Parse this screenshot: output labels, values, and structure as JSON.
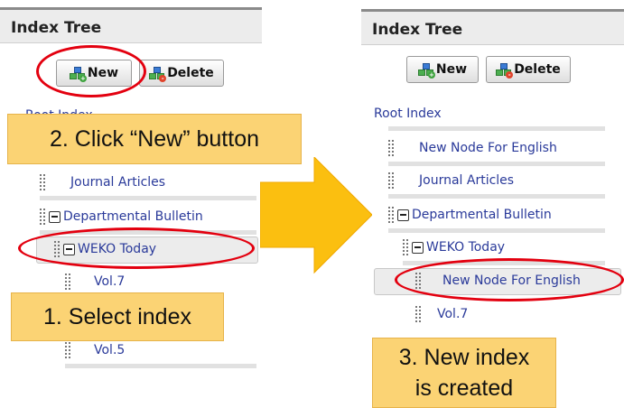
{
  "left_panel": {
    "title": "Index Tree",
    "new_label": "New",
    "delete_label": "Delete",
    "root_label": "Root Index",
    "tree": [
      {
        "label": "Journal Articles"
      },
      {
        "label": "Departmental Bulletin"
      },
      {
        "label": "WEKO Today"
      },
      {
        "label": "Vol.7"
      },
      {
        "label": "Vol.5"
      }
    ]
  },
  "right_panel": {
    "title": "Index Tree",
    "new_label": "New",
    "delete_label": "Delete",
    "root_label": "Root Index",
    "tree": [
      {
        "label": "New Node For English"
      },
      {
        "label": "Journal Articles"
      },
      {
        "label": "Departmental Bulletin"
      },
      {
        "label": "WEKO Today"
      },
      {
        "label": "New Node For English"
      },
      {
        "label": "Vol.7"
      }
    ]
  },
  "callouts": {
    "step1": "1. Select index",
    "step2": "2. Click “New” button",
    "step3_line1": "3. New index",
    "step3_line2": "is created"
  },
  "colors": {
    "highlight_ring": "#e3000f",
    "callout_fill": "#fbd374",
    "arrow_fill": "#fbbf10",
    "link": "#2a3a9a"
  }
}
